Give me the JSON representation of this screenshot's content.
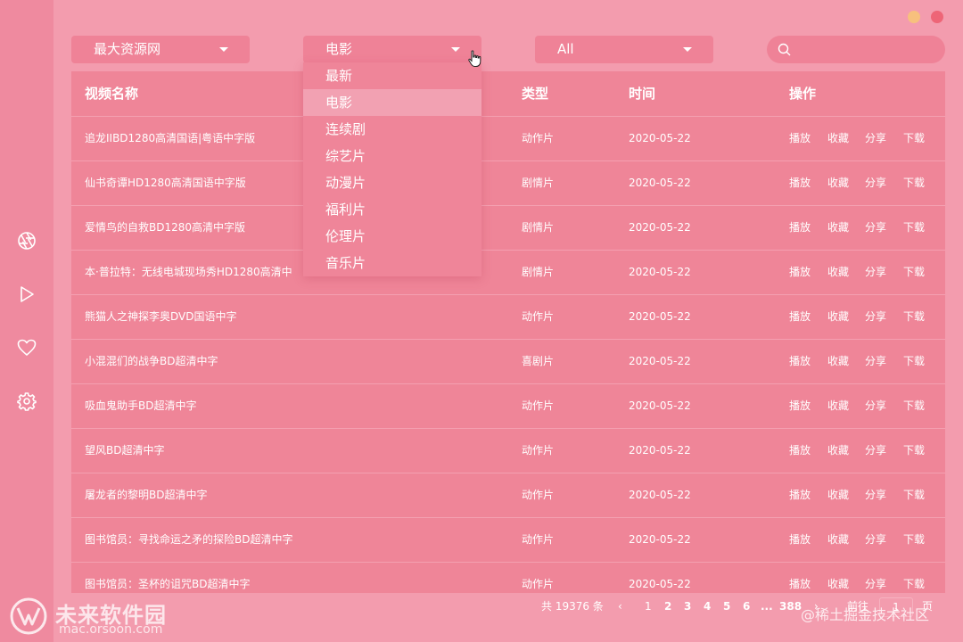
{
  "sidebar": {
    "icons": [
      "aperture-icon",
      "play-icon",
      "heart-icon",
      "gear-icon"
    ]
  },
  "filters": {
    "source": {
      "value": "最大资源网"
    },
    "category": {
      "value": "电影"
    },
    "sub": {
      "value": "All"
    }
  },
  "search": {
    "placeholder": ""
  },
  "dropdown": {
    "options": [
      "最新",
      "电影",
      "连续剧",
      "综艺片",
      "动漫片",
      "福利片",
      "伦理片",
      "音乐片"
    ],
    "active_index": 1
  },
  "table": {
    "columns": [
      "视频名称",
      "类型",
      "时间",
      "操作"
    ],
    "actions": [
      "播放",
      "收藏",
      "分享",
      "下载"
    ],
    "rows": [
      {
        "name": "追龙IIBD1280高清国语|粤语中字版",
        "type": "动作片",
        "date": "2020-05-22"
      },
      {
        "name": "仙书奇谭HD1280高清国语中字版",
        "type": "剧情片",
        "date": "2020-05-22"
      },
      {
        "name": "爱情鸟的自救BD1280高清中字版",
        "type": "剧情片",
        "date": "2020-05-22"
      },
      {
        "name": "本·普拉特：无线电城现场秀HD1280高清中",
        "type": "剧情片",
        "date": "2020-05-22"
      },
      {
        "name": "熊猫人之神探李奥DVD国语中字",
        "type": "动作片",
        "date": "2020-05-22"
      },
      {
        "name": "小混混们的战争BD超清中字",
        "type": "喜剧片",
        "date": "2020-05-22"
      },
      {
        "name": "吸血鬼助手BD超清中字",
        "type": "动作片",
        "date": "2020-05-22"
      },
      {
        "name": "望风BD超清中字",
        "type": "动作片",
        "date": "2020-05-22"
      },
      {
        "name": "屠龙者的黎明BD超清中字",
        "type": "动作片",
        "date": "2020-05-22"
      },
      {
        "name": "图书馆员：寻找命运之矛的探险BD超清中字",
        "type": "动作片",
        "date": "2020-05-22"
      },
      {
        "name": "图书馆员：圣杯的诅咒BD超清中字",
        "type": "动作片",
        "date": "2020-05-22"
      }
    ]
  },
  "pagination": {
    "total": "共 19376 条",
    "pages": [
      "1",
      "2",
      "3",
      "4",
      "5",
      "6",
      "...",
      "388"
    ],
    "goto_label": "前往",
    "goto_value": "1",
    "page_unit": "页"
  },
  "watermarks": {
    "left_title": "未来软件园",
    "left_sub": "mac.orsoon.com",
    "right": "@稀土掘金技术社区"
  }
}
